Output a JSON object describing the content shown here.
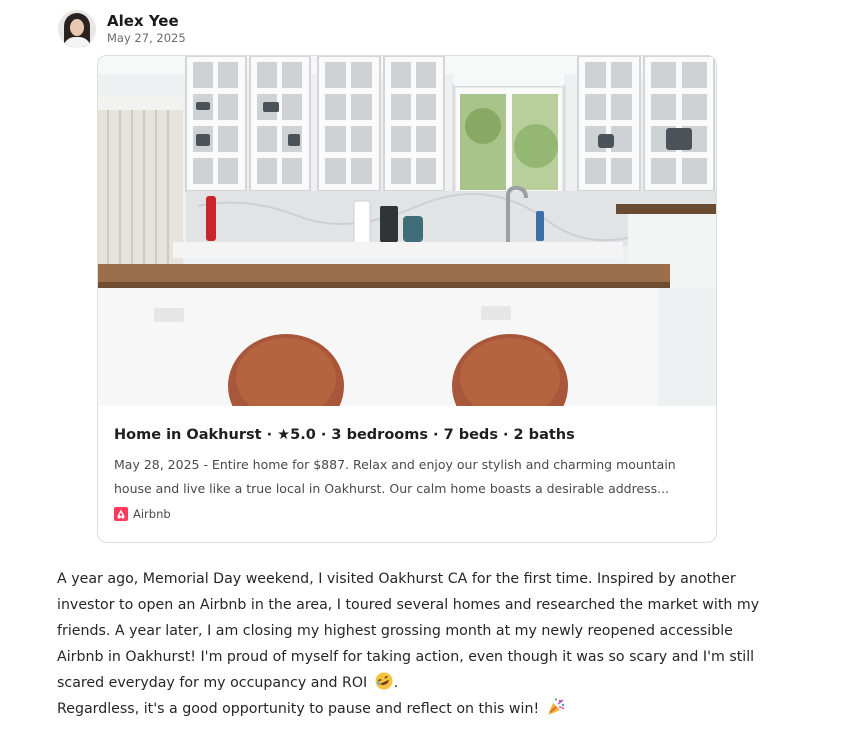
{
  "author": {
    "name": "Alex Yee",
    "date": "May 27, 2025",
    "avatar_icon": "profile-photo-icon"
  },
  "link_card": {
    "image_description_icon": "kitchen-photo",
    "title": "Home in Oakhurst · ★5.0 · 3 bedrooms · 7 beds · 2 baths",
    "description": "May 28, 2025 - Entire home for $887. Relax and enjoy our stylish and charming mountain house and live like a true local in Oakhurst. Our calm home boasts a desirable address...",
    "source": "Airbnb",
    "source_icon": "airbnb-logo-icon",
    "source_color": "#ff385c"
  },
  "post": {
    "paragraph_1": "A year ago, Memorial Day weekend, I visited Oakhurst CA for the first time. Inspired by another investor to open an Airbnb in the area, I toured several homes and researched the market with my friends. A year later, I am closing my highest grossing month at my newly reopened accessible Airbnb in Oakhurst! I'm proud of myself for taking action, even though it was so scary and I'm still scared everyday for my occupancy and ROI",
    "paragraph_1_end": ".",
    "paragraph_1_emoji": "rolling-on-floor-laughing-emoji",
    "paragraph_2": "Regardless, it's a good opportunity to pause and reflect on this win!",
    "paragraph_2_emoji": "party-popper-emoji"
  }
}
